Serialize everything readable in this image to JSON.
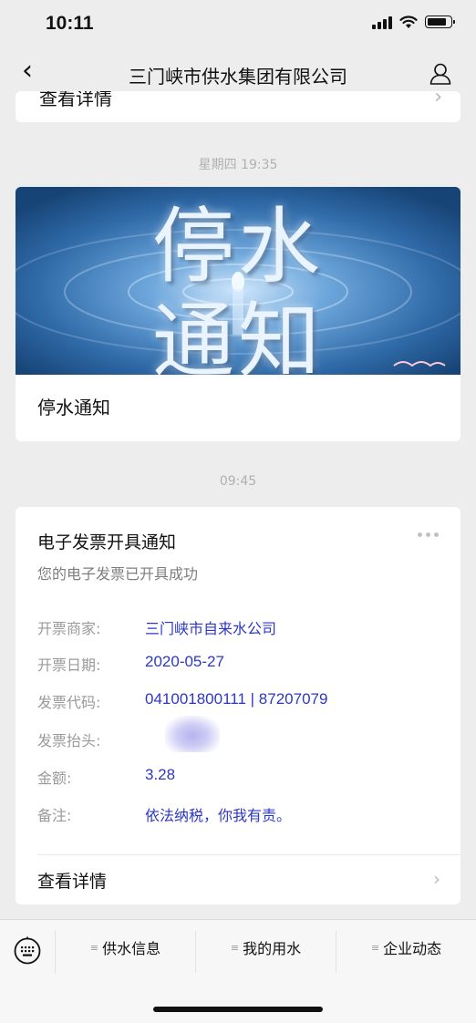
{
  "status_bar": {
    "time": "10:11"
  },
  "nav": {
    "title": "三门峡市供水集团有限公司"
  },
  "top_card": {
    "partial_text": "查看详情"
  },
  "timestamps": {
    "first": "星期四 19:35",
    "second": "09:45"
  },
  "article": {
    "banner_line1": "停水",
    "banner_line2": "通知",
    "title": "停水通知"
  },
  "invoice": {
    "title": "电子发票开具通知",
    "subtitle": "您的电子发票已开具成功",
    "rows": [
      {
        "label": "开票商家:",
        "value": "三门峡市自来水公司"
      },
      {
        "label": "开票日期:",
        "value": "2020-05-27"
      },
      {
        "label": "发票代码:",
        "value": "041001800111 | 87207079"
      },
      {
        "label": "发票抬头:",
        "value": ""
      },
      {
        "label": "金额:",
        "value": "3.28"
      },
      {
        "label": "备注:",
        "value": "依法纳税，你我有责。"
      }
    ],
    "detail_label": "查看详情"
  },
  "menu": {
    "items": [
      {
        "label": "供水信息"
      },
      {
        "label": "我的用水"
      },
      {
        "label": "企业动态"
      }
    ]
  },
  "colors": {
    "value_blue": "#2d37c6",
    "background": "#ededed"
  }
}
